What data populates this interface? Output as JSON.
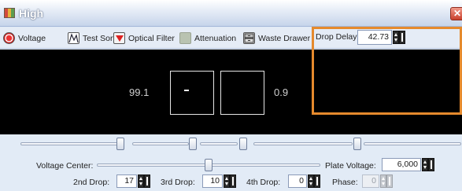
{
  "window": {
    "title": "High",
    "close_glyph": "✕"
  },
  "toolbar": {
    "voltage_label": "Voltage",
    "test_sort_label": "Test Sort",
    "optical_filter_label": "Optical Filter",
    "attenuation_label": "Attenuation",
    "waste_drawer_label": "Waste Drawer",
    "drop_delay_label": "Drop Delay:",
    "drop_delay_value": "42.73"
  },
  "display": {
    "left_value": "99.1",
    "right_value": "0.9"
  },
  "controls": {
    "voltage_center_label": "Voltage Center:",
    "plate_voltage_label": "Plate Voltage:",
    "plate_voltage_value": "6,000",
    "drop2_label": "2nd Drop:",
    "drop2_value": "17",
    "drop3_label": "3rd Drop:",
    "drop3_value": "10",
    "drop4_label": "4th Drop:",
    "drop4_value": "0",
    "phase_label": "Phase:",
    "phase_value": "0"
  },
  "colors": {
    "highlight": "#e58a2d",
    "display_background": "#000000"
  }
}
